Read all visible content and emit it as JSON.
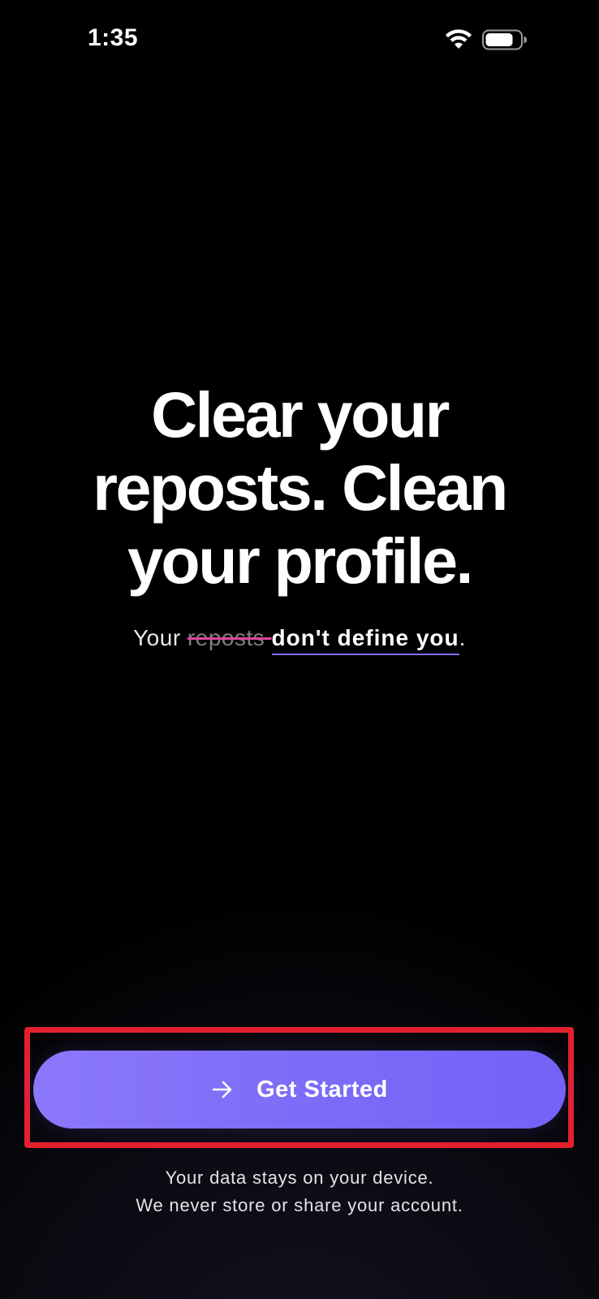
{
  "status_bar": {
    "time": "1:35",
    "wifi_icon": "wifi-icon",
    "battery_icon": "battery-icon"
  },
  "hero": {
    "title": "Clear your reposts. Clean your profile.",
    "tagline": {
      "prefix": "Your ",
      "struck": "reposts ",
      "emphasis": "don't define you",
      "suffix": "."
    }
  },
  "cta": {
    "label": "Get Started",
    "icon": "arrow-right-icon"
  },
  "privacy": {
    "line1": "Your data stays on your device.",
    "line2": "We never store or share your account."
  },
  "colors": {
    "accent": "#7e6cf8",
    "strike": "#e0449a",
    "underline": "#8a6cff",
    "highlight_box": "#e5202d"
  }
}
